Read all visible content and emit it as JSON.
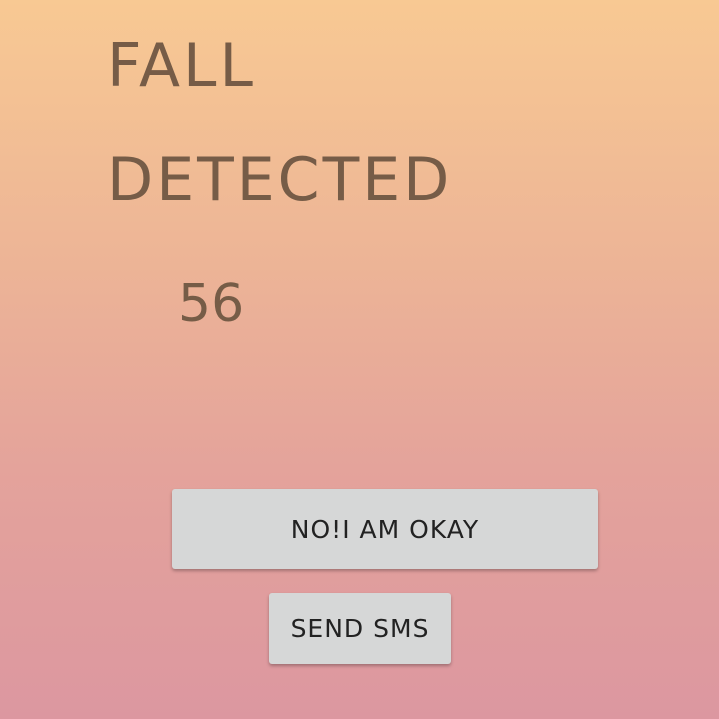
{
  "alert": {
    "title_line_1": "FALL",
    "title_line_2": "DETECTED",
    "countdown": "56"
  },
  "actions": {
    "okay_label": "NO!I AM OKAY",
    "sms_label": "SEND SMS"
  },
  "colors": {
    "background_top": "#f8c993",
    "background_bottom": "#dc97a0",
    "text": "#765c47",
    "button_background": "#d6d7d7",
    "button_text": "#222222"
  }
}
